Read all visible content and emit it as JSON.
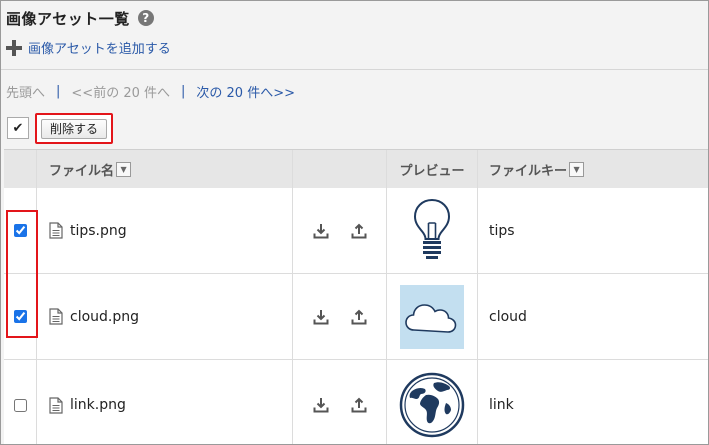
{
  "header": {
    "title": "画像アセット一覧",
    "help": "?"
  },
  "add_link": "画像アセットを追加する",
  "pager": {
    "first": "先頭へ",
    "sep": "|",
    "prev": "<<前の 20 件へ",
    "next": "次の 20 件へ>>"
  },
  "toolbar": {
    "select_all_mark": "✔",
    "delete_label": "削除する"
  },
  "table": {
    "columns": {
      "file_name": "ファイル名",
      "actions": "",
      "preview": "プレビュー",
      "file_key": "ファイルキー"
    },
    "rows": [
      {
        "checked": true,
        "file_name": "tips.png",
        "preview": "lightbulb",
        "file_key": "tips"
      },
      {
        "checked": true,
        "file_name": "cloud.png",
        "preview": "cloud",
        "file_key": "cloud"
      },
      {
        "checked": false,
        "file_name": "link.png",
        "preview": "globe",
        "file_key": "link"
      }
    ]
  },
  "icons": {
    "help": "help-circle-icon",
    "add": "plus-icon",
    "sort": "dropdown-arrow-icon",
    "file": "document-icon",
    "download": "download-icon",
    "upload": "upload-icon"
  },
  "colors": {
    "link": "#2a59a8",
    "highlight": "#e3151a",
    "cloud_bg": "#c3dff0"
  }
}
